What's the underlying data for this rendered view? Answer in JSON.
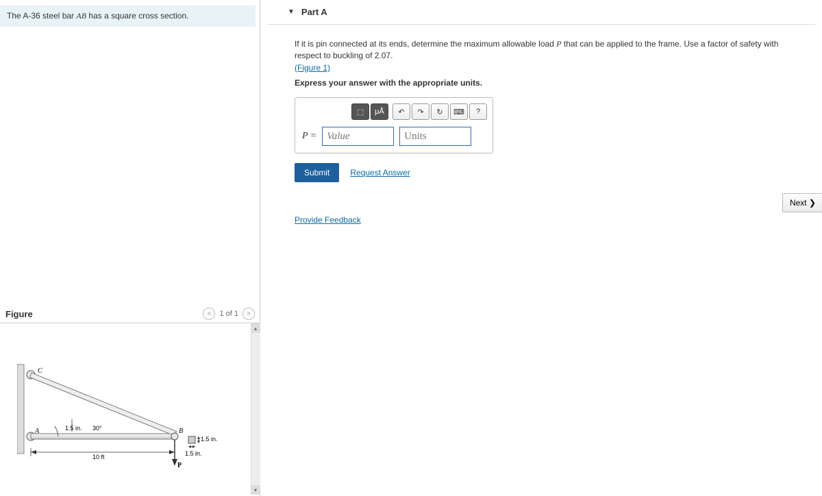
{
  "problem": {
    "text_before": "The A-36 steel bar ",
    "var": "AB",
    "text_after": " has a square cross section."
  },
  "figure": {
    "title": "Figure",
    "page_label": "1 of 1",
    "labels": {
      "C": "C",
      "A": "A",
      "B": "B",
      "P": "P",
      "angle": "30°",
      "dim_bar": "1.5 in.",
      "dim_span": "10 ft",
      "dim_cs1": "1.5 in.",
      "dim_cs2": "1.5 in."
    }
  },
  "part": {
    "title": "Part A",
    "prompt_before": "If it is pin connected at its ends, determine the maximum allowable load ",
    "prompt_var": "P",
    "prompt_after": " that can be applied to the frame. Use a factor of safety with respect to buckling of 2.07.",
    "figure_link": "(Figure 1)",
    "instruction": "Express your answer with the appropriate units.",
    "answer_label": "P =",
    "value_placeholder": "Value",
    "units_placeholder": "Units",
    "toolbar": {
      "templates": "⬚",
      "units_btn": "μÅ",
      "undo": "↶",
      "redo": "↷",
      "reset": "↻",
      "keyboard": "⌨",
      "help": "?"
    },
    "submit": "Submit",
    "request_answer": "Request Answer",
    "provide_feedback": "Provide Feedback",
    "next": "Next ❯"
  }
}
